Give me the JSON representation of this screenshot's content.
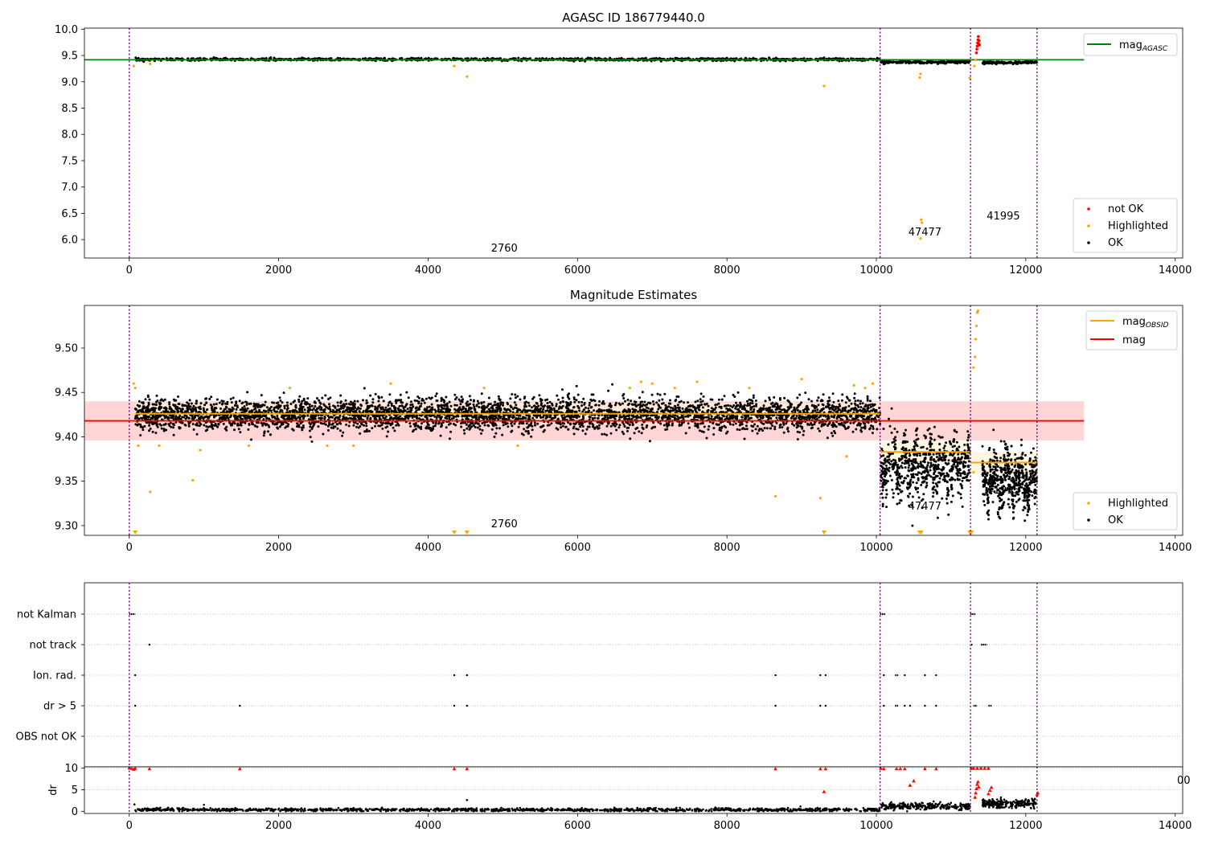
{
  "colors": {
    "ok": "#000000",
    "highlighted": "#ffa500",
    "not_ok": "#ff0000",
    "agasc_line": "#008000",
    "obsid_line": "#ffa500",
    "mag_line": "#ff0000",
    "mag_band": "#ffd5d5",
    "obsid_band": "#fff3d6",
    "obs_boundary": "#800080",
    "grid": "#b0b0b0"
  },
  "obs_boundaries": [
    0,
    10050,
    11260,
    12150
  ],
  "chart_data": [
    {
      "type": "scatter",
      "title": "AGASC ID 186779440.0",
      "xlim": [
        -600,
        14100
      ],
      "ylim": [
        5.65,
        10.02
      ],
      "xticks": [
        0,
        2000,
        4000,
        6000,
        8000,
        10000,
        12000,
        14000
      ],
      "xtick_labels": [
        "0",
        "2000",
        "4000",
        "6000",
        "8000",
        "10000",
        "12000",
        "14000"
      ],
      "yticks": [
        6.0,
        6.5,
        7.0,
        7.5,
        8.0,
        8.5,
        9.0,
        9.5,
        10.0
      ],
      "ytick_labels": [
        "6.0",
        "6.5",
        "7.0",
        "7.5",
        "8.0",
        "8.5",
        "9.0",
        "9.5",
        "10.0"
      ],
      "segments": [
        {
          "x0": 80,
          "x1": 10050,
          "mean": 9.425,
          "sd": 0.012,
          "n": 1400,
          "dip": 0
        },
        {
          "x0": 10060,
          "x1": 11250,
          "mean": 9.375,
          "sd": 0.012,
          "n": 220,
          "dip": 0
        },
        {
          "x0": 11420,
          "x1": 12150,
          "mean": 9.365,
          "sd": 0.012,
          "n": 170,
          "dip": 0
        }
      ],
      "line": {
        "name": "mag",
        "subscript": "AGASC",
        "y": 9.418,
        "x0": -600,
        "x1": 12780
      },
      "highlighted_points": [
        [
          60,
          9.3
        ],
        [
          280,
          9.34
        ],
        [
          4350,
          9.3
        ],
        [
          4520,
          9.1
        ],
        [
          9300,
          8.92
        ],
        [
          10580,
          9.08
        ],
        [
          10590,
          9.15
        ],
        [
          10600,
          6.38
        ],
        [
          10610,
          6.32
        ],
        [
          10590,
          6.02
        ],
        [
          11250,
          9.07
        ],
        [
          11310,
          9.3
        ],
        [
          11330,
          9.42
        ]
      ],
      "not_ok_points": [
        [
          11340,
          9.55
        ],
        [
          11345,
          9.62
        ],
        [
          11350,
          9.68
        ],
        [
          11355,
          9.74
        ],
        [
          11360,
          9.8
        ],
        [
          11365,
          9.86
        ],
        [
          11370,
          9.72
        ],
        [
          11375,
          9.78
        ],
        [
          11380,
          9.7
        ]
      ],
      "annotations": [
        {
          "text": "2760",
          "x": 5020,
          "y": 5.77
        },
        {
          "text": "47477",
          "x": 10650,
          "y": 6.08
        },
        {
          "text": "41995",
          "x": 11700,
          "y": 6.38
        }
      ],
      "legend_top": {
        "entries": [
          {
            "name": "mag",
            "subscript": "AGASC"
          }
        ]
      },
      "legend_bottom": {
        "entries": [
          "not OK",
          "Highlighted",
          "OK"
        ]
      }
    },
    {
      "type": "scatter",
      "title": "Magnitude Estimates",
      "xlim": [
        -600,
        14100
      ],
      "ylim": [
        9.289,
        9.548
      ],
      "xticks": [
        0,
        2000,
        4000,
        6000,
        8000,
        10000,
        12000,
        14000
      ],
      "xtick_labels": [
        "0",
        "2000",
        "4000",
        "6000",
        "8000",
        "10000",
        "12000",
        "14000"
      ],
      "yticks": [
        9.3,
        9.35,
        9.4,
        9.45,
        9.5
      ],
      "ytick_labels": [
        "9.30",
        "9.35",
        "9.40",
        "9.45",
        "9.50"
      ],
      "segments": [
        {
          "x0": 80,
          "x1": 10050,
          "mean": 9.425,
          "sd": 0.009,
          "n": 4200,
          "dip": 0
        },
        {
          "x0": 10060,
          "x1": 11250,
          "mean": 9.383,
          "sd": 0.016,
          "n": 700,
          "dip": 0.025
        },
        {
          "x0": 11420,
          "x1": 12150,
          "mean": 9.372,
          "sd": 0.014,
          "n": 550,
          "dip": 0.03
        }
      ],
      "mag_line": {
        "name": "mag",
        "y": 9.418,
        "band": [
          9.396,
          9.44
        ],
        "x0": -600,
        "x1": 12780
      },
      "obsid_lines": [
        {
          "x0": 80,
          "x1": 10050,
          "y": 9.426
        },
        {
          "x0": 10060,
          "x1": 11250,
          "y": 9.383
        },
        {
          "x0": 11260,
          "x1": 12150,
          "y": 9.371
        }
      ],
      "obsid_legend": {
        "name": "mag",
        "subscript": "OBSID"
      },
      "highlighted_points": [
        [
          60,
          9.46
        ],
        [
          80,
          9.455
        ],
        [
          120,
          9.39
        ],
        [
          280,
          9.338
        ],
        [
          400,
          9.39
        ],
        [
          850,
          9.351
        ],
        [
          950,
          9.385
        ],
        [
          1600,
          9.39
        ],
        [
          2150,
          9.455
        ],
        [
          2650,
          9.39
        ],
        [
          3000,
          9.39
        ],
        [
          3500,
          9.46
        ],
        [
          4750,
          9.455
        ],
        [
          5200,
          9.39
        ],
        [
          6700,
          9.455
        ],
        [
          6850,
          9.462
        ],
        [
          7000,
          9.46
        ],
        [
          7300,
          9.455
        ],
        [
          7600,
          9.462
        ],
        [
          8300,
          9.455
        ],
        [
          8650,
          9.333
        ],
        [
          9000,
          9.465
        ],
        [
          9250,
          9.331
        ],
        [
          9600,
          9.378
        ],
        [
          9700,
          9.458
        ],
        [
          9850,
          9.455
        ],
        [
          9950,
          9.46
        ],
        [
          11300,
          9.478
        ],
        [
          11320,
          9.49
        ],
        [
          11330,
          9.51
        ],
        [
          11340,
          9.525
        ],
        [
          11350,
          9.54
        ],
        [
          11360,
          9.542
        ],
        [
          11300,
          9.36
        ]
      ],
      "clipped_markers": [
        80,
        4350,
        4520,
        9300,
        10580,
        10600,
        11250,
        11270
      ],
      "annotations": [
        {
          "text": "2760",
          "x": 5020,
          "y": 9.298
        },
        {
          "text": "47477",
          "x": 10650,
          "y": 9.318
        },
        {
          "text": "41995",
          "x": 11700,
          "y": 9.336
        }
      ],
      "legend_bottom": {
        "entries": [
          "Highlighted",
          "OK"
        ]
      }
    },
    {
      "type": "scatter",
      "title": "",
      "xlim": [
        -600,
        14100
      ],
      "flag_rows": [
        "not Kalman",
        "not track",
        "Ion. rad.",
        "dr > 5",
        "OBS not OK"
      ],
      "flag_points": {
        "not Kalman": [
          [
            0,
            80
          ],
          [
            10050,
            10120
          ],
          [
            11260,
            11330
          ]
        ],
        "not track": [
          [
            270,
            270
          ],
          [
            11270,
            11290
          ],
          [
            11400,
            11480
          ]
        ],
        "Ion. rad.": [
          [
            80,
            80
          ],
          [
            4350,
            4350
          ],
          [
            4520,
            4520
          ],
          [
            8650,
            8650
          ],
          [
            9250,
            9250
          ],
          [
            9320,
            9320
          ],
          [
            10100,
            10100
          ],
          [
            10250,
            10300
          ],
          [
            10380,
            10380
          ],
          [
            10650,
            10650
          ],
          [
            10800,
            10800
          ]
        ],
        "dr > 5": [
          [
            80,
            80
          ],
          [
            1480,
            1480
          ],
          [
            4350,
            4350
          ],
          [
            4520,
            4520
          ],
          [
            8650,
            8650
          ],
          [
            9250,
            9250
          ],
          [
            9320,
            9320
          ],
          [
            10100,
            10100
          ],
          [
            10250,
            10300
          ],
          [
            10380,
            10380
          ],
          [
            10450,
            10450
          ],
          [
            10650,
            10650
          ],
          [
            10800,
            10800
          ],
          [
            11300,
            11350
          ],
          [
            11500,
            11550
          ]
        ],
        "OBS not OK": []
      }
    },
    {
      "type": "scatter",
      "title": "",
      "ylabel": "dr",
      "xlim": [
        -600,
        14100
      ],
      "ylim": [
        -0.5,
        10.3
      ],
      "xticks": [
        0,
        2000,
        4000,
        6000,
        8000,
        10000,
        12000,
        14000
      ],
      "xtick_labels": [
        "0",
        "2000",
        "4000",
        "6000",
        "8000",
        "10000",
        "12000",
        "14000"
      ],
      "yticks": [
        0,
        5,
        10
      ],
      "ytick_labels": [
        "0",
        "5",
        "10"
      ],
      "ok_segments": [
        {
          "x0": 80,
          "x1": 10050,
          "mean": 0.35,
          "sd": 0.18,
          "n": 1300
        },
        {
          "x0": 10060,
          "x1": 11250,
          "mean": 1.2,
          "sd": 0.4,
          "n": 260
        },
        {
          "x0": 11420,
          "x1": 12150,
          "mean": 1.8,
          "sd": 0.5,
          "n": 220
        }
      ],
      "extra_ok_points": [
        [
          70,
          1.6
        ],
        [
          1000,
          1.5
        ],
        [
          4520,
          2.6
        ],
        [
          12000,
          2.8
        ],
        [
          12100,
          2.5
        ]
      ],
      "not_ok_points": [
        [
          0,
          10
        ],
        [
          30,
          9.9
        ],
        [
          60,
          9.7
        ],
        [
          80,
          9.9
        ],
        [
          270,
          9.8
        ],
        [
          1480,
          9.8
        ],
        [
          4350,
          9.8
        ],
        [
          4520,
          9.8
        ],
        [
          8650,
          9.8
        ],
        [
          9250,
          9.8
        ],
        [
          9320,
          9.8
        ],
        [
          10060,
          9.9
        ],
        [
          10100,
          9.8
        ],
        [
          10270,
          9.8
        ],
        [
          10320,
          9.8
        ],
        [
          10380,
          9.8
        ],
        [
          10500,
          7.0
        ],
        [
          10450,
          6.0
        ],
        [
          10650,
          9.8
        ],
        [
          10800,
          9.8
        ],
        [
          11270,
          9.9
        ],
        [
          11300,
          9.9
        ],
        [
          11350,
          9.9
        ],
        [
          11400,
          9.9
        ],
        [
          11450,
          9.9
        ],
        [
          11500,
          9.9
        ],
        [
          9300,
          4.5
        ],
        [
          11320,
          3.2
        ],
        [
          11330,
          4.2
        ],
        [
          11340,
          5.2
        ],
        [
          11350,
          6.2
        ],
        [
          11360,
          6.8
        ],
        [
          11370,
          5.6
        ],
        [
          11500,
          4.0
        ],
        [
          11520,
          4.8
        ],
        [
          11540,
          5.5
        ],
        [
          12150,
          3.8
        ],
        [
          12160,
          4.2
        ]
      ],
      "stray_label": "00"
    }
  ]
}
